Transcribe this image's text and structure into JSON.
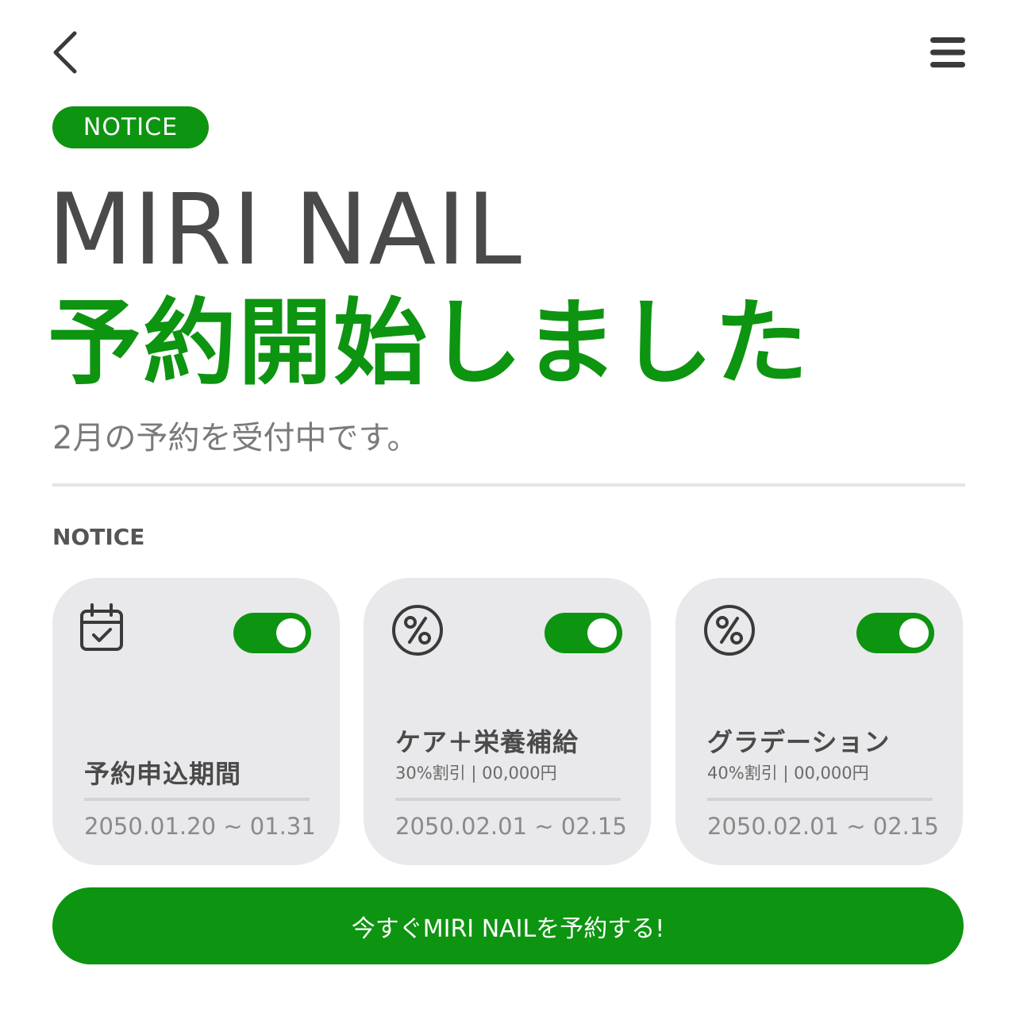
{
  "header": {
    "back_icon": "chevron-left-icon",
    "menu_icon": "hamburger-menu-icon"
  },
  "badge": {
    "label": "NOTICE"
  },
  "hero": {
    "brand": "MIRI NAIL",
    "headline": "予約開始しました",
    "subtitle": "2月の予約を受付中です。"
  },
  "section": {
    "label": "NOTICE"
  },
  "cards": [
    {
      "icon": "calendar-check-icon",
      "toggle_on": true,
      "title": "予約申込期間",
      "subtitle": "",
      "date": "2050.01.20 ~ 01.31"
    },
    {
      "icon": "percent-icon",
      "toggle_on": true,
      "title": "ケア＋栄養補給",
      "subtitle": "30%割引 | 00,000円",
      "date": "2050.02.01 ~ 02.15"
    },
    {
      "icon": "percent-icon",
      "toggle_on": true,
      "title": "グラデーション",
      "subtitle": "40%割引 | 00,000円",
      "date": "2050.02.01 ~ 02.15"
    }
  ],
  "cta": {
    "label": "今すぐMIRI NAILを予約する!"
  },
  "colors": {
    "accent": "#0d9410",
    "card_bg": "#e9e8ea",
    "text_dark": "#4a4a4a",
    "text_muted": "#8a8a8a"
  }
}
